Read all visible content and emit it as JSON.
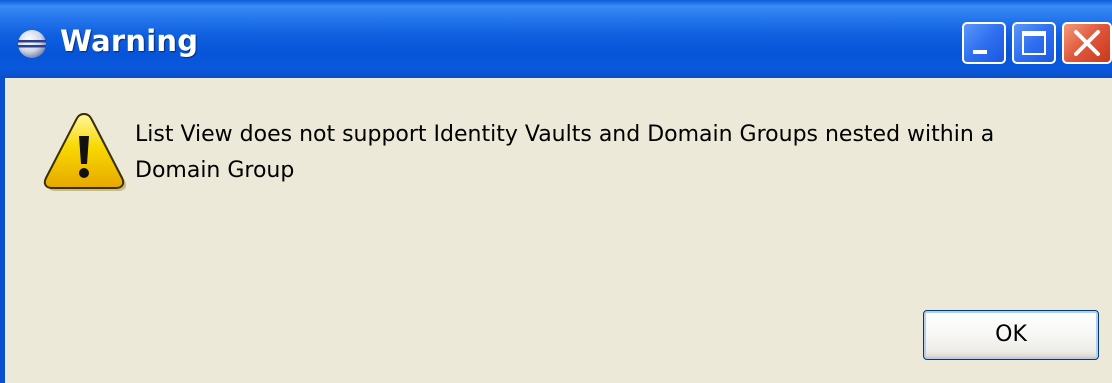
{
  "window": {
    "title": "Warning",
    "title_icon": "eclipse-icon",
    "controls": {
      "minimize_icon": "minimize-icon",
      "maximize_icon": "maximize-icon",
      "close_icon": "close-icon"
    }
  },
  "dialog": {
    "icon": "warning-icon",
    "message": "List View does not support Identity Vaults and Domain Groups nested within a Domain Group",
    "ok_label": "OK"
  },
  "colors": {
    "titlebar_blue": "#0a5fd8",
    "dialog_background": "#ece9d8",
    "close_red": "#e0563a",
    "warning_yellow": "#f8d800"
  }
}
